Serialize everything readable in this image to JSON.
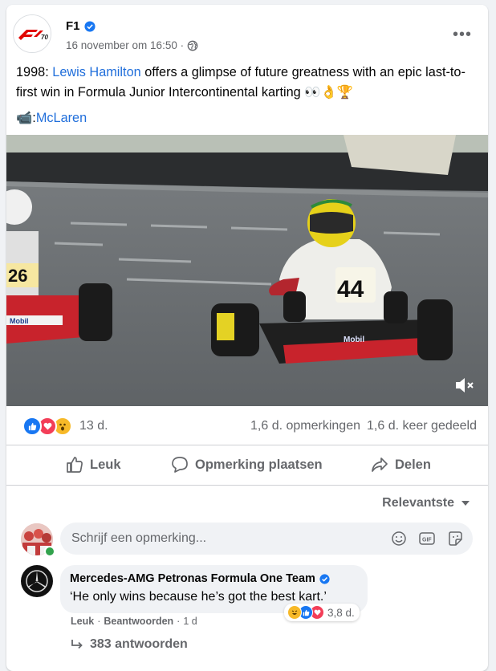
{
  "post": {
    "page_name": "F1",
    "logo_text": "F1 70",
    "timestamp": "16 november om 16:50 ·",
    "text_prefix": "1998: ",
    "text_link": "Lewis Hamilton",
    "text_body": " offers a glimpse of future greatness with an epic last-to-first win in Formula Junior Intercontinental karting 👀👌🏆",
    "credit_icon": "📹",
    "credit_sep": ": ",
    "credit_link": "McLaren"
  },
  "video": {
    "kart_left_number": "26",
    "kart_right_number": "44",
    "sponsor": "Mobil"
  },
  "stats": {
    "reaction_count": "13 d.",
    "comments": "1,6 d. opmerkingen",
    "shares": "1,6 d. keer gedeeld"
  },
  "actions": {
    "like": "Leuk",
    "comment": "Opmerking plaatsen",
    "share": "Delen"
  },
  "sort": {
    "label": "Relevantste"
  },
  "composer": {
    "placeholder": "Schrijf een opmerking..."
  },
  "comment": {
    "author": "Mercedes-AMG Petronas Formula One Team",
    "text": "‘He only wins because he’s got the best kart.’",
    "reaction_count": "3,8 d.",
    "like": "Leuk",
    "reply": "Beantwoorden",
    "time": "1 d",
    "replies": "383 antwoorden"
  },
  "colors": {
    "link": "#216fdb",
    "secondary": "#65676b",
    "like_blue": "#1877f2",
    "love_red": "#f33e58"
  }
}
